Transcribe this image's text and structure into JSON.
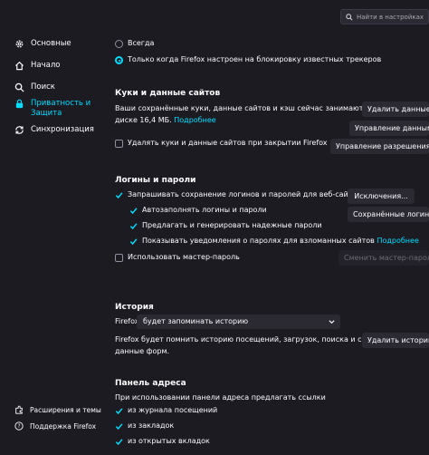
{
  "search": {
    "placeholder": "Найти в настройках"
  },
  "sidebar": {
    "items": [
      {
        "label": "Основные",
        "icon": "gear-icon"
      },
      {
        "label": "Начало",
        "icon": "home-icon"
      },
      {
        "label": "Поиск",
        "icon": "search-icon"
      },
      {
        "label": "Приватность и Защита",
        "label_line1": "Приватность и",
        "label_line2": "Защита",
        "icon": "lock-icon",
        "active": true
      },
      {
        "label": "Синхронизация",
        "icon": "sync-icon"
      }
    ],
    "footer": [
      {
        "label": "Расширения и темы",
        "icon": "puzzle-icon"
      },
      {
        "label": "Поддержка Firefox",
        "icon": "help-icon"
      }
    ]
  },
  "tracking": {
    "options": [
      {
        "label": "Всегда",
        "selected": false
      },
      {
        "label": "Только когда Firefox настроен на блокировку известных трекеров",
        "selected": true
      }
    ]
  },
  "cookies": {
    "title": "Куки и данные сайтов",
    "desc_line1": "Ваши сохранённые куки, данные сайтов и кэш сейчас занимают на",
    "desc_line2": "диске 16,4 МБ.",
    "more_link": "Подробнее",
    "delete_on_close": "Удалять куки и данные сайтов при закрытии Firefox",
    "delete_button": "Удалить данные...",
    "manage_button": "Управление данными...",
    "permissions_button": "Управление разрешениями..."
  },
  "logins": {
    "title": "Логины и пароли",
    "ask_save": "Запрашивать сохранение логинов и паролей для веб-сайтов",
    "autofill": "Автозаполнять логины и пароли",
    "suggest": "Предлагать и генерировать надежные пароли",
    "breach_alerts": "Показывать уведомления о паролях для взломанных сайтов",
    "breach_more": "Подробнее",
    "master_password": "Использовать мастер-пароль",
    "exceptions_button": "Исключения...",
    "saved_logins_button": "Сохранённые логины...",
    "change_master_button": "Сменить мастер-пароль..."
  },
  "history": {
    "title": "История",
    "firefox_label": "Firefox",
    "mode_value": "будет запоминать историю",
    "desc_line1": "Firefox будет помнить историю посещений, загрузок, поиска и сохранять",
    "desc_line2": "данные форм.",
    "delete_button": "Удалить историю..."
  },
  "addressbar": {
    "title": "Панель адреса",
    "desc": "При использовании панели адреса предлагать ссылки",
    "items": [
      {
        "label": "из журнала посещений",
        "checked": true
      },
      {
        "label": "из закладок",
        "checked": true
      },
      {
        "label": "из открытых вкладок",
        "checked": true
      }
    ]
  },
  "colors": {
    "background": "#1c1b22",
    "accent": "#00ddff",
    "control": "#2b2a33",
    "text": "#fbfbfe"
  }
}
